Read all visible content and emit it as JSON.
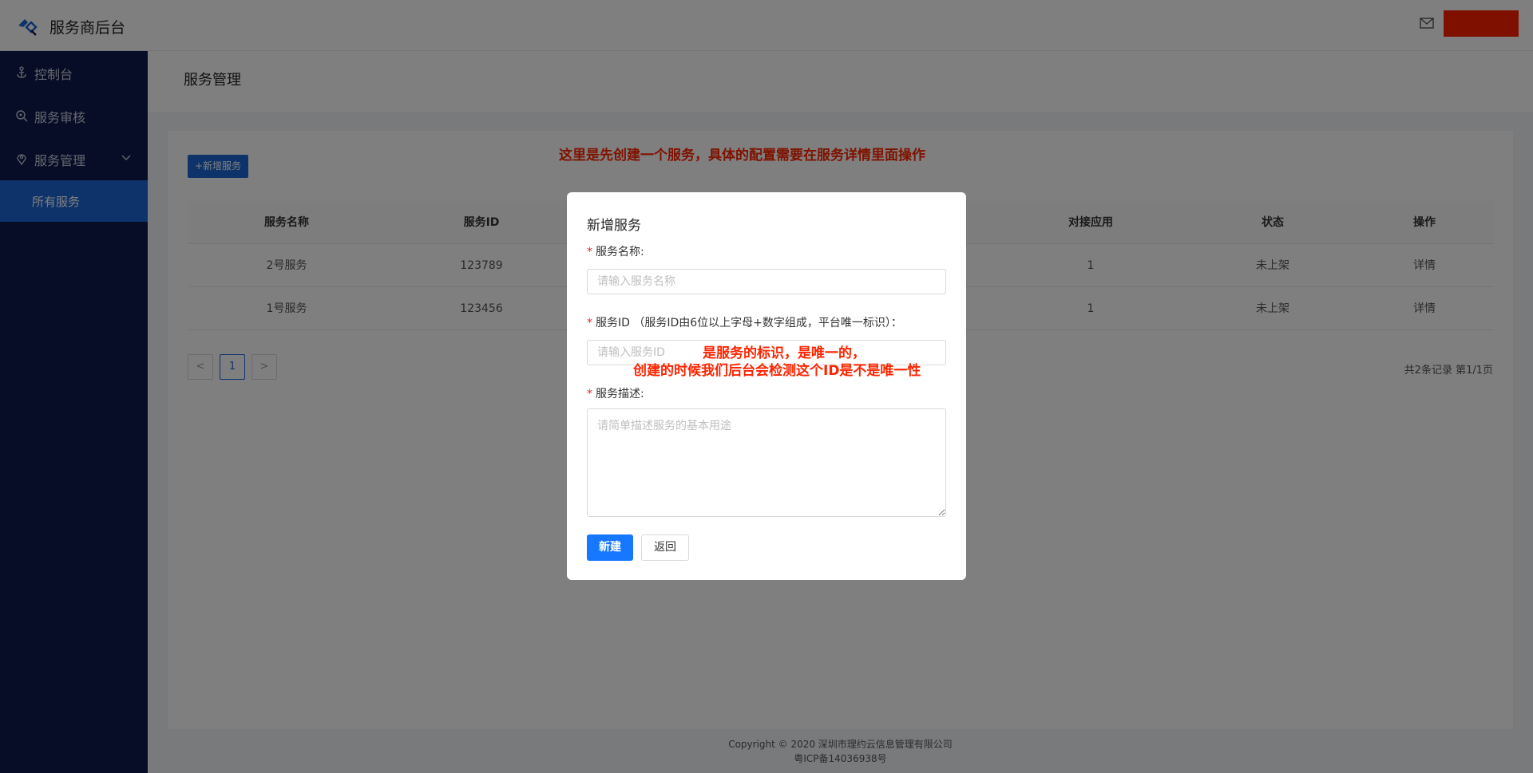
{
  "header": {
    "app_title": "服务商后台",
    "logo_icon": "logo-icon",
    "mail_icon": "mail-icon",
    "user_block_color": "#ff2000"
  },
  "sidebar": {
    "items": [
      {
        "label": "控制台",
        "icon": "anchor-icon"
      },
      {
        "label": "服务审核",
        "icon": "search-icon"
      },
      {
        "label": "服务管理",
        "icon": "location-pin-icon",
        "expanded": true
      }
    ],
    "sub_items": [
      {
        "label": "所有服务",
        "active": true
      }
    ]
  },
  "page": {
    "title": "服务管理",
    "add_button": "+新增服务",
    "annotation_top": "这里是先创建一个服务，具体的配置需要在服务详情里面操作"
  },
  "table": {
    "columns": [
      "服务名称",
      "服务ID",
      "对接应用",
      "状态",
      "操作"
    ],
    "rows": [
      {
        "name": "2号服务",
        "id": "123789",
        "apps": "1",
        "status": "未上架",
        "action": "详情"
      },
      {
        "name": "1号服务",
        "id": "123456",
        "apps": "1",
        "status": "未上架",
        "action": "详情"
      }
    ]
  },
  "pagination": {
    "prev": "<",
    "current": "1",
    "next": ">",
    "info": "共2条记录 第1/1页"
  },
  "footer": {
    "copyright": "Copyright © 2020 深圳市理约云信息管理有限公司",
    "icp": "粤ICP备14036938号"
  },
  "modal": {
    "title": "新增服务",
    "name_label": "服务名称:",
    "name_placeholder": "请输入服务名称",
    "id_label": "服务ID （服务ID由6位以上字母+数字组成，平台唯一标识）：",
    "id_placeholder": "请输入服务ID",
    "annotation_line1": "是服务的标识，是唯一的，",
    "annotation_line2": "创建的时候我们后台会检测这个ID是不是唯一性",
    "desc_label": "服务描述:",
    "desc_placeholder": "请简单描述服务的基本用途",
    "create_button": "新建",
    "back_button": "返回",
    "required_mark": "*"
  },
  "colors": {
    "primary": "#1d66d6",
    "sidebar_bg": "#0e1a4d",
    "annotation": "#ff2400"
  }
}
